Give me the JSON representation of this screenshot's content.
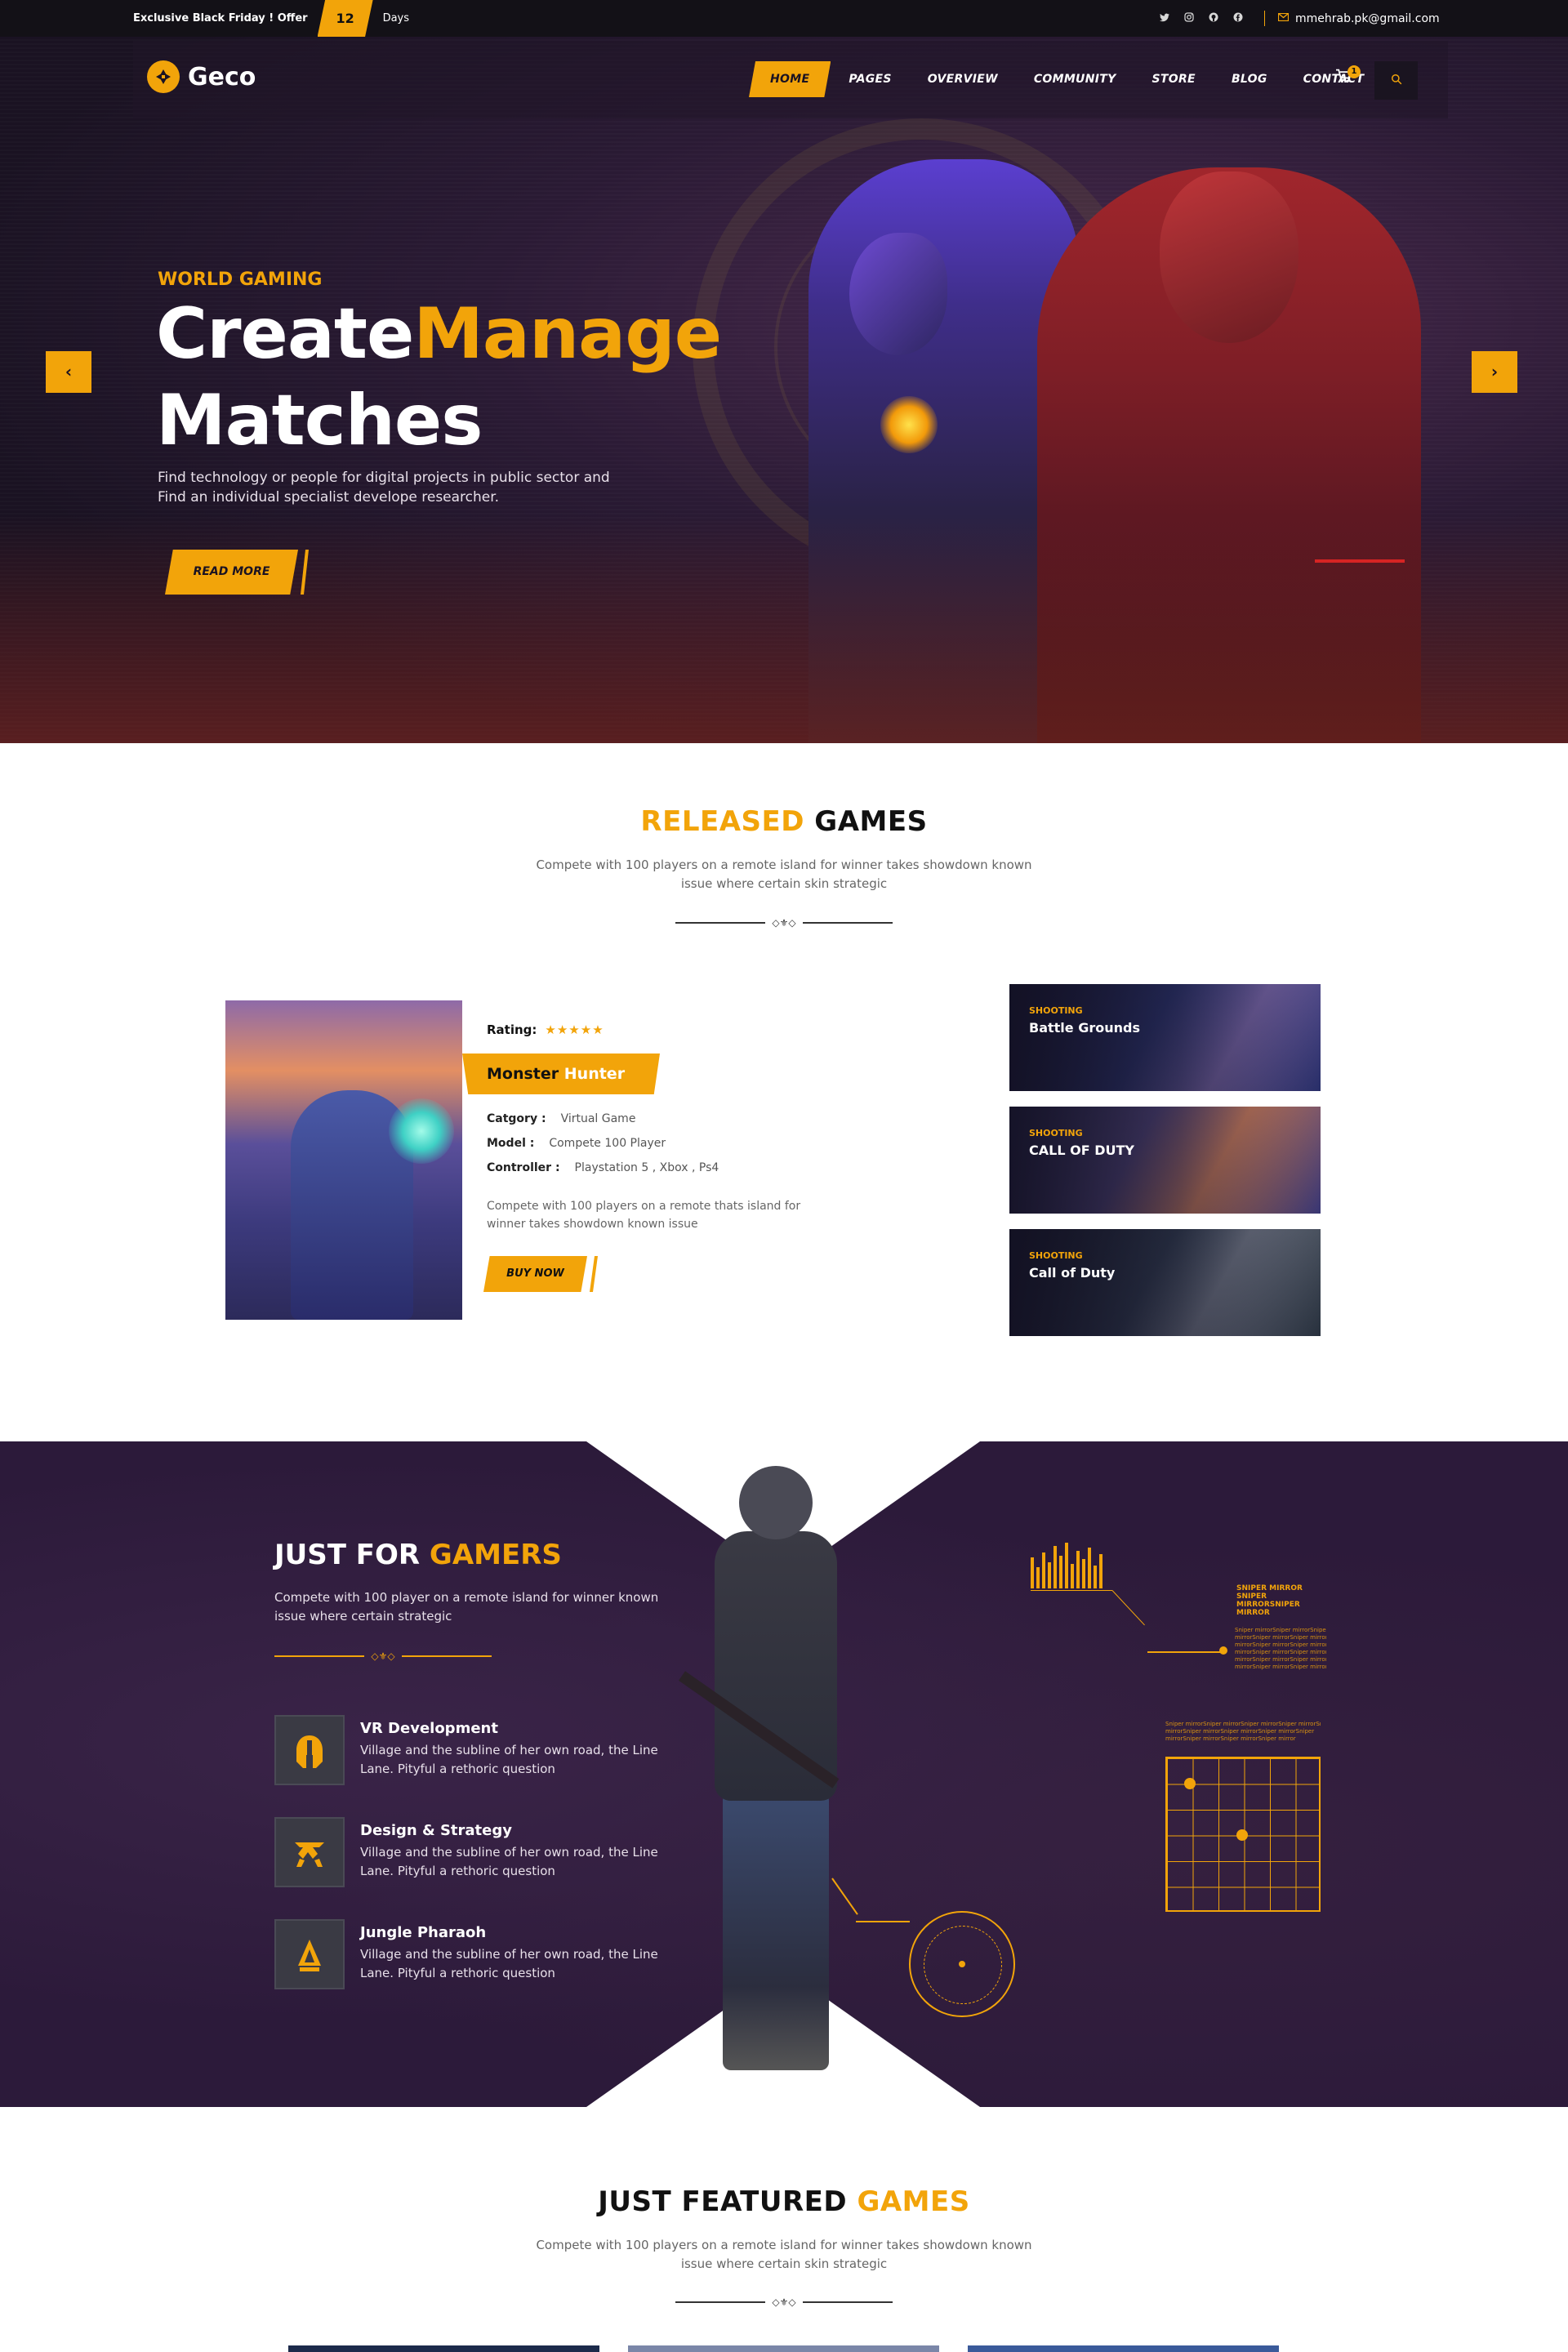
{
  "topbar": {
    "offer_text": "Exclusive Black Friday ! Offer",
    "offer_number": "12",
    "offer_unit": "Days",
    "social_icons": [
      "twitter-icon",
      "instagram-icon",
      "github-icon",
      "facebook-icon"
    ],
    "email": "mmehrab.pk@gmail.com"
  },
  "nav": {
    "logo": "Geco",
    "menu": [
      "HOME",
      "PAGES",
      "OVERVIEW",
      "COMMUNITY",
      "STORE",
      "BLOG",
      "CONTACT"
    ],
    "active": "HOME",
    "cart_count": "1"
  },
  "hero": {
    "eyebrow": "WORLD GAMING",
    "title_word1": "Create",
    "title_word2": "Manage",
    "title_line2": "Matches",
    "description": "Find technology or people for digital projects in public sector and Find an individual specialist develope researcher.",
    "cta": "READ MORE",
    "prev_icon": "‹",
    "next_icon": "›"
  },
  "released": {
    "title_hl": "RELEASED",
    "title_rest": " GAMES",
    "subtitle": "Compete with 100 players on a remote island for winner takes showdown known issue where certain skin strategic",
    "featured_game": {
      "rating_label": "Rating:",
      "stars": "★★★★★",
      "name_main": "Monster",
      "name_hl": "Hunter",
      "category_label": "Catgory :",
      "category": "Virtual Game",
      "model_label": "Model :",
      "model": "Compete 100 Player",
      "controller_label": "Controller :",
      "controller": "Playstation 5 , Xbox , Ps4",
      "description": "Compete with 100 players on a remote thats island for winner takes showdown known issue",
      "cta": "BUY NOW"
    },
    "side_games": [
      {
        "category": "SHOOTING",
        "title": "Battle Grounds"
      },
      {
        "category": "SHOOTING",
        "title": "CALL OF DUTY"
      },
      {
        "category": "SHOOTING",
        "title": "Call of Duty"
      }
    ]
  },
  "gamers": {
    "title_main": "JUST FOR",
    "title_hl": " GAMERS",
    "subtitle": "Compete with 100 player on a remote island for winner known issue where certain strategic",
    "features": [
      {
        "icon": "spartan-helmet-icon",
        "title": "VR Development",
        "text": "Village and the subline of her own road, the Line Lane. Pityful a rethoric question"
      },
      {
        "icon": "fnatic-logo-icon",
        "title": "Design & Strategy",
        "text": "Village and the subline of her own road, the Line Lane. Pityful a rethoric question"
      },
      {
        "icon": "pharaoh-icon",
        "title": "Jungle Pharaoh",
        "text": "Village and the subline of her own road, the Line Lane. Pityful a rethoric question"
      }
    ],
    "hud_label": "SNIPER MIRROR SNIPER MIRRORSNIPER MIRROR",
    "hud_dots_a": "Sniper mirrorSniper mirrorSniper mirrorSniper\nmirrorSniper mirrorSniper mirrorSniper\nmirrorSniper mirrorSniper mirrorSniper\nmirrorSniper mirrorSniper mirrorSniper\nmirrorSniper mirrorSniper mirrorSniper\nmirrorSniper mirrorSniper mirror",
    "hud_dots_b": "Sniper mirrorSniper mirrorSniper mirrorSniper mirrorSniper\nmirrorSniper mirrorSniper mirrorSniper mirrorSniper\nmirrorSniper mirrorSniper mirrorSniper mirror"
  },
  "featured": {
    "title_main": "JUST FEATURED",
    "title_hl": " GAMES",
    "subtitle": "Compete with 100 players on a remote island for winner takes showdown known issue where certain skin strategic"
  },
  "colors": {
    "accent": "#f2a40a",
    "dark": "#1a1222",
    "section_dark": "#2c1a3a"
  }
}
